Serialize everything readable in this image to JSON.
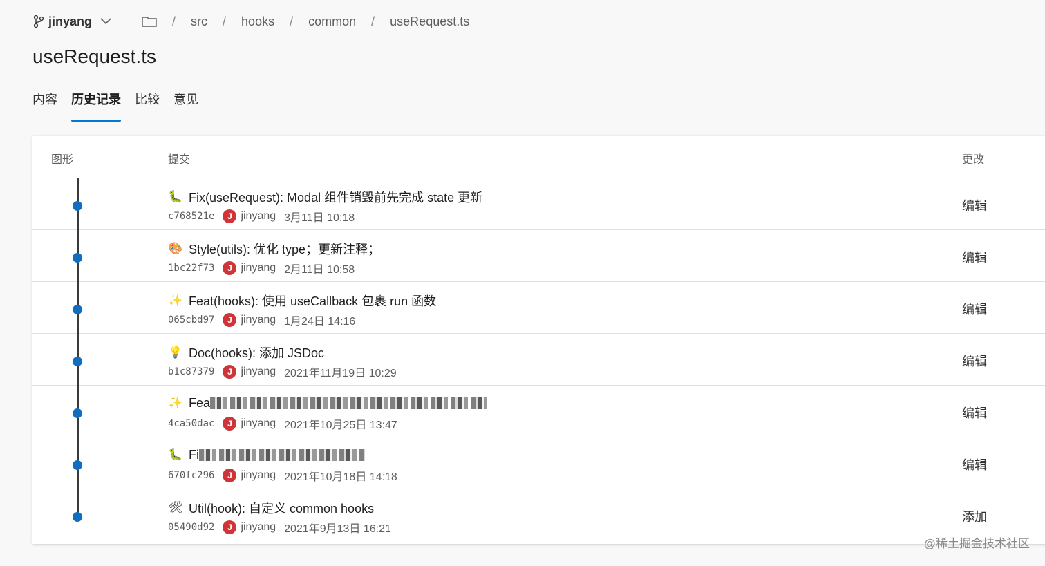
{
  "header": {
    "branch": "jinyang",
    "breadcrumb": [
      "src",
      "hooks",
      "common",
      "useRequest.ts"
    ],
    "separator": "/"
  },
  "page_title": "useRequest.ts",
  "tabs": [
    {
      "label": "内容",
      "active": false
    },
    {
      "label": "历史记录",
      "active": true
    },
    {
      "label": "比较",
      "active": false
    },
    {
      "label": "意见",
      "active": false
    }
  ],
  "table": {
    "columns": {
      "graph": "图形",
      "commit": "提交",
      "change": "更改"
    },
    "rows": [
      {
        "icon": "🐛",
        "icon_name": "bug-icon",
        "message": "Fix(useRequest): Modal 组件销毁前先完成 state 更新",
        "hash": "c768521e",
        "avatar": "J",
        "author": "jinyang",
        "date": "3月11日 10:18",
        "change": "编辑"
      },
      {
        "icon": "🎨",
        "icon_name": "palette-icon",
        "message": "Style(utils): 优化 type；更新注释；",
        "hash": "1bc22f73",
        "avatar": "J",
        "author": "jinyang",
        "date": "2月11日 10:58",
        "change": "编辑"
      },
      {
        "icon": "✨",
        "icon_name": "sparkles-icon",
        "message": "Feat(hooks): 使用 useCallback 包裹 run 函数",
        "hash": "065cbd97",
        "avatar": "J",
        "author": "jinyang",
        "date": "1月24日 14:16",
        "change": "编辑"
      },
      {
        "icon": "💡",
        "icon_name": "lightbulb-icon",
        "message": "Doc(hooks): 添加 JSDoc",
        "hash": "b1c87379",
        "avatar": "J",
        "author": "jinyang",
        "date": "2021年11月19日 10:29",
        "change": "编辑"
      },
      {
        "icon": "✨",
        "icon_name": "sparkles-icon",
        "message": "Fea",
        "blurred": true,
        "hash": "4ca50dac",
        "avatar": "J",
        "author": "jinyang",
        "date": "2021年10月25日 13:47",
        "change": "编辑"
      },
      {
        "icon": "🐛",
        "icon_name": "bug-icon",
        "message": "Fi",
        "blurred": true,
        "hash": "670fc296",
        "avatar": "J",
        "author": "jinyang",
        "date": "2021年10月18日 14:18",
        "change": "编辑"
      },
      {
        "icon": "🛠",
        "icon_name": "tools-icon",
        "message": "Util(hook): 自定义 common hooks",
        "hash": "05490d92",
        "avatar": "J",
        "author": "jinyang",
        "date": "2021年9月13日 16:21",
        "change": "添加"
      }
    ]
  },
  "watermark": "@稀土掘金技术社区",
  "colors": {
    "accent": "#0078d4",
    "graph_dot": "#106ebe",
    "avatar_bg": "#d13438"
  }
}
